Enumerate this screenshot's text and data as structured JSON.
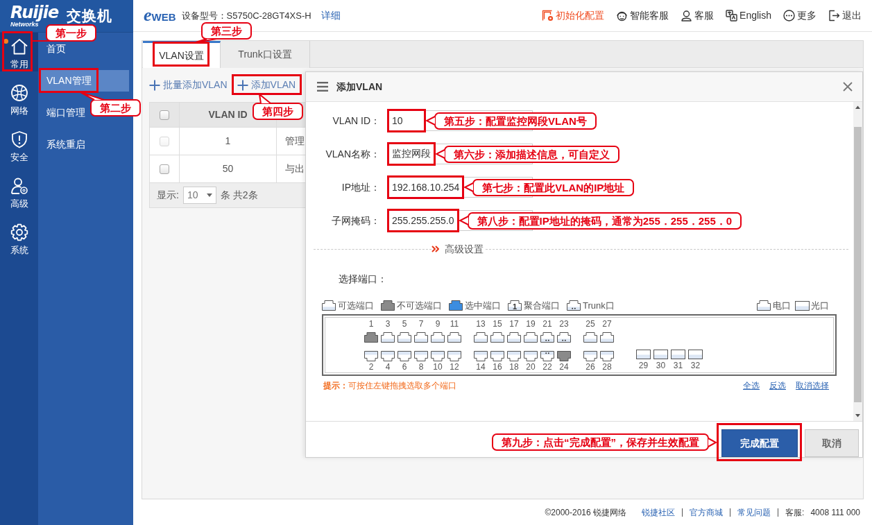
{
  "logo": {
    "brand": "Ruijie",
    "tagline": "Networks",
    "product": "交换机"
  },
  "rail": [
    {
      "label": "常用",
      "selected": true,
      "callout": "第一步"
    },
    {
      "label": "网络",
      "selected": false
    },
    {
      "label": "安全",
      "selected": false
    },
    {
      "label": "高级",
      "selected": false
    },
    {
      "label": "系统",
      "selected": false
    }
  ],
  "subnav": [
    {
      "label": "首页",
      "selected": false
    },
    {
      "label": "VLAN管理",
      "selected": true,
      "callout": "第二步"
    },
    {
      "label": "端口管理",
      "selected": false
    },
    {
      "label": "系统重启",
      "selected": false
    }
  ],
  "topbar": {
    "logo": {
      "initial": "e",
      "rest": "WEB"
    },
    "model_label": "设备型号：",
    "model": "S5750C-28GT4XS-H",
    "details_link": "详细",
    "actions": [
      {
        "label": "初始化配置",
        "highlighted": true
      },
      {
        "label": "智能客服",
        "highlighted": false
      },
      {
        "label": "客服",
        "highlighted": false
      },
      {
        "label": "English",
        "highlighted": false
      },
      {
        "label": "更多",
        "highlighted": false
      },
      {
        "label": "退出",
        "highlighted": false
      }
    ]
  },
  "tabs": [
    {
      "label": "VLAN设置",
      "selected": true,
      "callout": "第三步"
    },
    {
      "label": "Trunk口设置",
      "selected": false
    }
  ],
  "toolbar": [
    {
      "label": "批量添加VLAN"
    },
    {
      "label": "添加VLAN",
      "callout": "第四步"
    }
  ],
  "table": {
    "select_all_checked": false,
    "columns": [
      "VLAN ID"
    ],
    "rows": [
      {
        "checked": false,
        "disabled": true,
        "cells": [
          "1",
          "管理"
        ]
      },
      {
        "checked": false,
        "disabled": false,
        "cells": [
          "50",
          "与出"
        ]
      }
    ],
    "footer": {
      "show_label": "显示:",
      "page_size": "10",
      "count": "条 共2条"
    }
  },
  "dialog": {
    "title": "添加VLAN",
    "fields": [
      {
        "label": "VLAN ID：",
        "value": "10",
        "callout": "第五步：配置监控网段VLAN号"
      },
      {
        "label": "VLAN名称：",
        "value": "监控网段",
        "callout": "第六步：添加描述信息，可自定义"
      },
      {
        "label": "IP地址：",
        "value": "192.168.10.254",
        "callout": "第七步：配置此VLAN的IP地址"
      },
      {
        "label": "子网掩码：",
        "value": "255.255.255.0",
        "callout": "第八步：配置IP地址的掩码，通常为255．255．255．0"
      }
    ],
    "advanced_label": "高级设置",
    "ports_label": "选择端口：",
    "legend": [
      {
        "kind": "available",
        "label": "可选端口"
      },
      {
        "kind": "unavailable",
        "label": "不可选端口"
      },
      {
        "kind": "selected",
        "label": "选中端口"
      },
      {
        "kind": "aggregate",
        "label": "聚合端口",
        "mark": "1"
      },
      {
        "kind": "trunk",
        "label": "Trunk口"
      }
    ],
    "media_legend": [
      {
        "kind": "copper",
        "label": "电口"
      },
      {
        "kind": "fiber",
        "label": "光口"
      }
    ],
    "port_groups": [
      {
        "kind": "copper",
        "top": [
          {
            "number": "1",
            "disabled": true,
            "trunk": false,
            "selected": false
          },
          {
            "number": "3",
            "disabled": false,
            "trunk": false,
            "selected": false
          },
          {
            "number": "5",
            "disabled": false,
            "trunk": false,
            "selected": false
          },
          {
            "number": "7",
            "disabled": false,
            "trunk": false,
            "selected": false
          },
          {
            "number": "9",
            "disabled": false,
            "trunk": false,
            "selected": false
          },
          {
            "number": "11",
            "disabled": false,
            "trunk": false,
            "selected": false
          }
        ],
        "bottom": [
          {
            "number": "2",
            "disabled": false,
            "trunk": false,
            "selected": false
          },
          {
            "number": "4",
            "disabled": false,
            "trunk": false,
            "selected": false
          },
          {
            "number": "6",
            "disabled": false,
            "trunk": false,
            "selected": false
          },
          {
            "number": "8",
            "disabled": false,
            "trunk": false,
            "selected": false
          },
          {
            "number": "10",
            "disabled": false,
            "trunk": false,
            "selected": false
          },
          {
            "number": "12",
            "disabled": false,
            "trunk": false,
            "selected": false
          }
        ]
      },
      {
        "kind": "copper",
        "top": [
          {
            "number": "13",
            "disabled": false,
            "trunk": false,
            "selected": false
          },
          {
            "number": "15",
            "disabled": false,
            "trunk": false,
            "selected": false
          },
          {
            "number": "17",
            "disabled": false,
            "trunk": false,
            "selected": false
          },
          {
            "number": "19",
            "disabled": false,
            "trunk": false,
            "selected": false
          },
          {
            "number": "21",
            "disabled": false,
            "trunk": true,
            "selected": false
          },
          {
            "number": "23",
            "disabled": false,
            "trunk": true,
            "selected": false
          }
        ],
        "bottom": [
          {
            "number": "14",
            "disabled": false,
            "trunk": false,
            "selected": false
          },
          {
            "number": "16",
            "disabled": false,
            "trunk": false,
            "selected": false
          },
          {
            "number": "18",
            "disabled": false,
            "trunk": false,
            "selected": false
          },
          {
            "number": "20",
            "disabled": false,
            "trunk": false,
            "selected": false
          },
          {
            "number": "22",
            "disabled": false,
            "trunk": true,
            "selected": false
          },
          {
            "number": "24",
            "disabled": true,
            "trunk": false,
            "selected": false
          }
        ]
      },
      {
        "kind": "copper",
        "top": [
          {
            "number": "25",
            "disabled": false,
            "trunk": false,
            "selected": false
          },
          {
            "number": "27",
            "disabled": false,
            "trunk": false,
            "selected": false
          }
        ],
        "bottom": [
          {
            "number": "26",
            "disabled": false,
            "trunk": false,
            "selected": false
          },
          {
            "number": "28",
            "disabled": false,
            "trunk": false,
            "selected": false
          }
        ]
      },
      {
        "kind": "fiber",
        "bottom": [
          {
            "number": "29",
            "disabled": false,
            "trunk": false,
            "selected": false
          },
          {
            "number": "30",
            "disabled": false,
            "trunk": false,
            "selected": false
          },
          {
            "number": "31",
            "disabled": false,
            "trunk": false,
            "selected": false
          },
          {
            "number": "32",
            "disabled": false,
            "trunk": false,
            "selected": false
          }
        ]
      }
    ],
    "hint": "**提示：**可按住左键拖拽选取多个端口",
    "selection_links": [
      "全选",
      "反选",
      "取消选择"
    ],
    "buttons": [
      {
        "label": "完成配置",
        "kind": "primary",
        "callout": "第九步：点击“完成配置”，保存并生效配置"
      },
      {
        "label": "取消",
        "kind": "secondary"
      }
    ]
  },
  "footer": {
    "copyright": "©2000-2016 锐捷网络",
    "links": [
      "锐捷社区",
      "官方商城",
      "常见问题"
    ],
    "service_label": "客服:",
    "service_phone": "4008 111 000"
  }
}
